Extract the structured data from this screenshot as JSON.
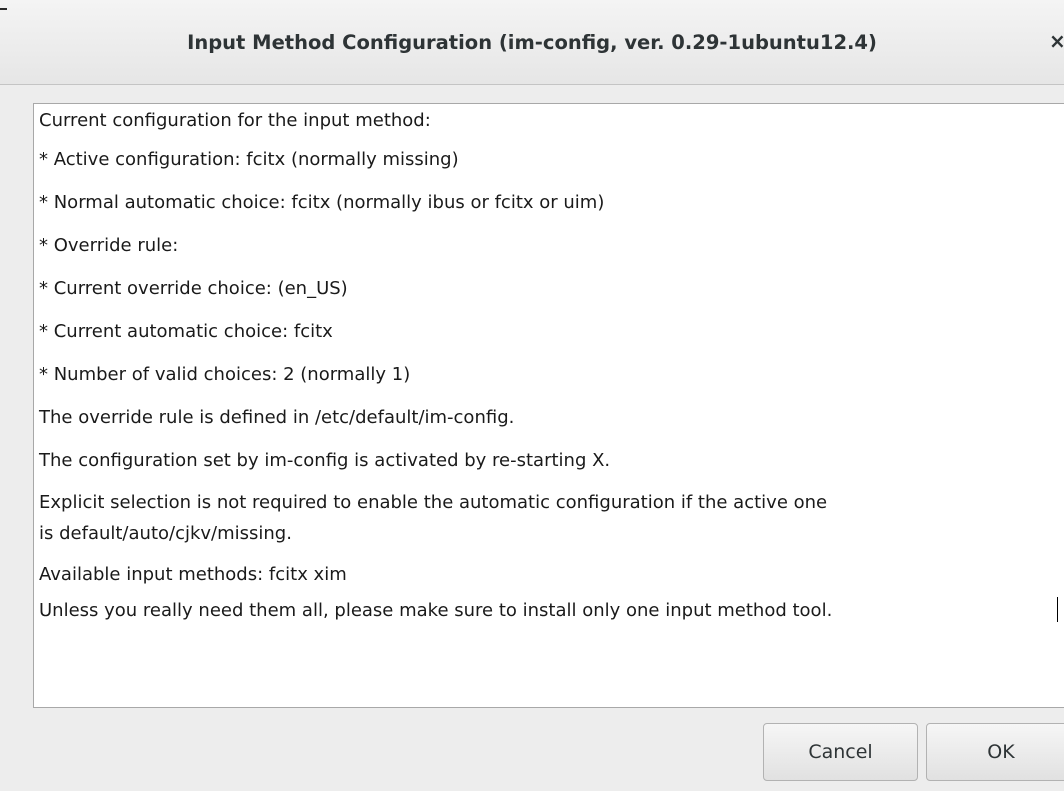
{
  "window": {
    "title": "Input Method Configuration (im-config, ver. 0.29-1ubuntu12.4)",
    "close_glyph": "×"
  },
  "content": {
    "lines": [
      "Current configuration for the input method:",
      " * Active configuration: fcitx (normally missing)",
      " * Normal automatic choice: fcitx (normally ibus or fcitx or uim)",
      " * Override rule:",
      " * Current override choice:  (en_US)",
      " * Current automatic choice: fcitx",
      " * Number of valid choices: 2 (normally 1)",
      "The override rule is defined in /etc/default/im-config.",
      "The configuration set by im-config is activated by re-starting X.",
      "Explicit selection is not required to enable the automatic configuration if the active one",
      "is default/auto/cjkv/missing.",
      "  Available input methods: fcitx xim",
      "Unless you really need them all, please make sure to install only one input method tool."
    ]
  },
  "buttons": {
    "cancel_label": "Cancel",
    "ok_label": "OK"
  }
}
